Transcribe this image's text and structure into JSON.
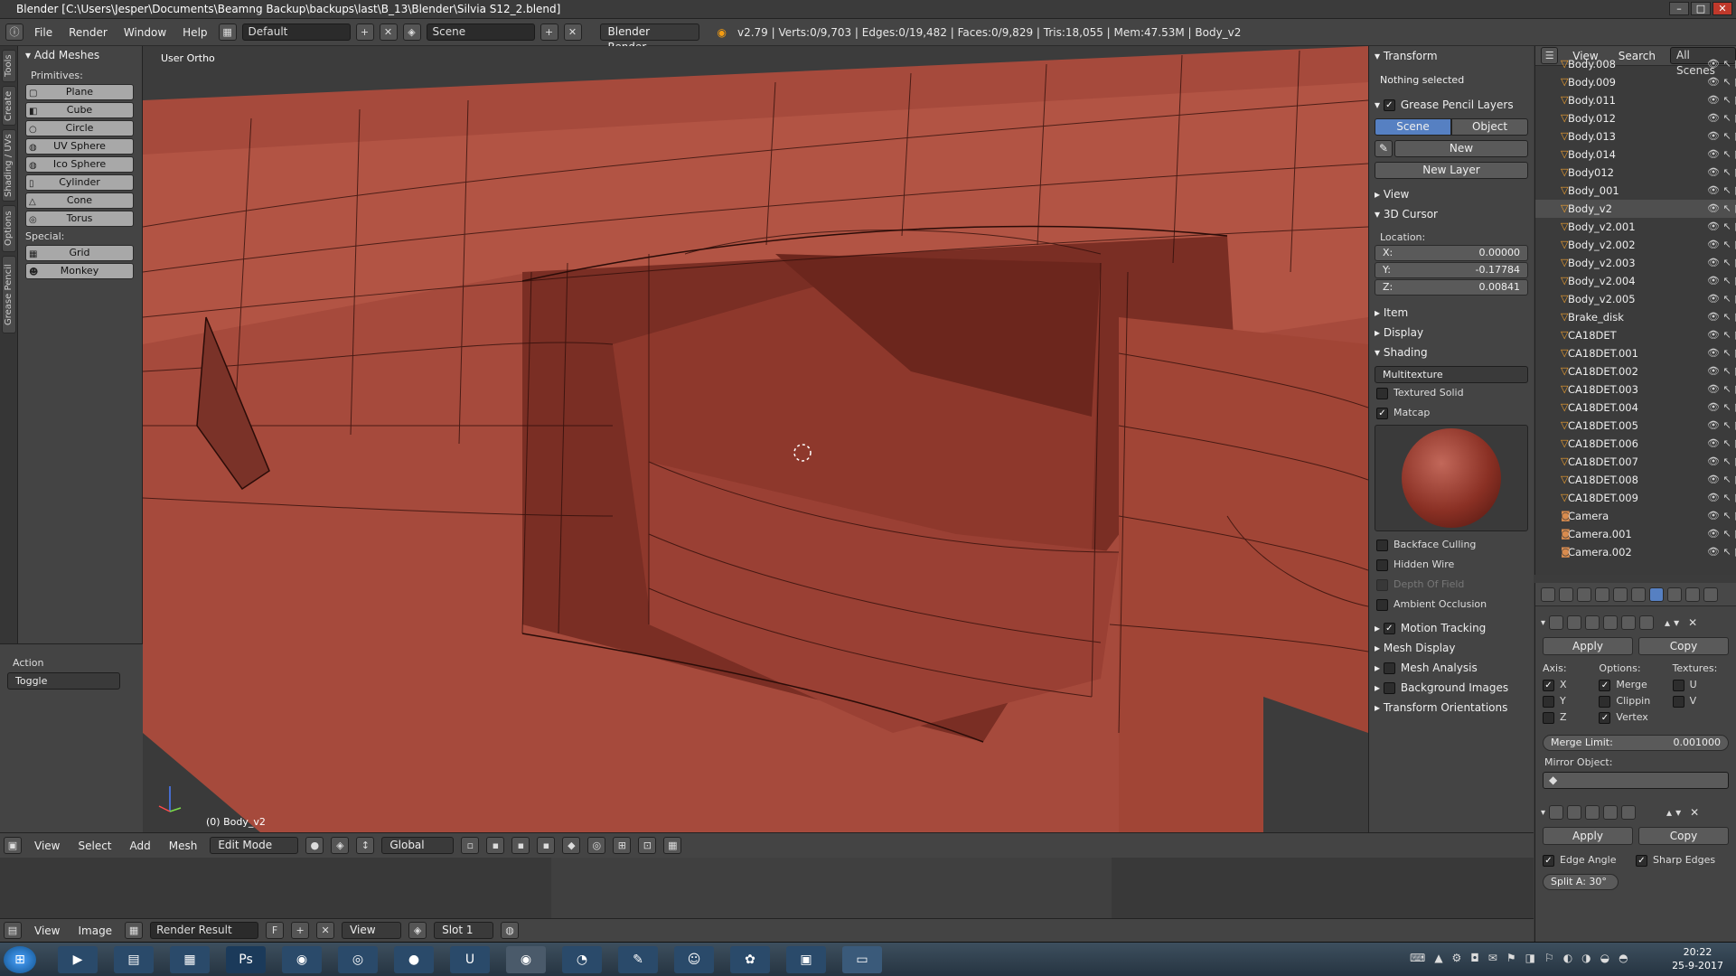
{
  "window": {
    "title": "Blender [C:\\Users\\Jesper\\Documents\\Beamng Backup\\backups\\last\\B_13\\Blender\\Silvia S12_2.blend]"
  },
  "topbar": {
    "menus": [
      "File",
      "Render",
      "Window",
      "Help"
    ],
    "layout": "Default",
    "scene": "Scene",
    "engine": "Blender Render",
    "stats": "v2.79 | Verts:0/9,703 | Edges:0/19,482 | Faces:0/9,829 | Tris:18,055 | Mem:47.53M | Body_v2"
  },
  "left_tabs": [
    "Tools",
    "Create",
    "Shading / UVs",
    "Options",
    "Grease Pencil"
  ],
  "toolshelf": {
    "header": "Add Meshes",
    "primitives_label": "Primitives:",
    "primitives": [
      "Plane",
      "Cube",
      "Circle",
      "UV Sphere",
      "Ico Sphere",
      "Cylinder",
      "Cone",
      "Torus"
    ],
    "special_label": "Special:",
    "special": [
      "Grid",
      "Monkey"
    ],
    "action_label": "Action",
    "action_value": "Toggle"
  },
  "viewport": {
    "view_label": "User Ortho",
    "object_label": "(0) Body_v2",
    "mesh_color": "#9e4236"
  },
  "npanel": {
    "transform": "Transform",
    "nothing_selected": "Nothing selected",
    "grease_pencil": "Grease Pencil Layers",
    "gp_scene": "Scene",
    "gp_object": "Object",
    "gp_new": "New",
    "gp_new_layer": "New Layer",
    "view": "View",
    "cursor": "3D Cursor",
    "location": "Location:",
    "x_label": "X:",
    "x_value": "0.00000",
    "y_label": "Y:",
    "y_value": "-0.17784",
    "z_label": "Z:",
    "z_value": "0.00841",
    "item": "Item",
    "display": "Display",
    "shading": "Shading",
    "shading_mode": "Multitexture",
    "textured_solid": "Textured Solid",
    "matcap": "Matcap",
    "backface": "Backface Culling",
    "hidden_wire": "Hidden Wire",
    "depth_of_field": "Depth Of Field",
    "ambient": "Ambient Occlusion",
    "motion_tracking": "Motion Tracking",
    "mesh_display": "Mesh Display",
    "mesh_analysis": "Mesh Analysis",
    "background_images": "Background Images",
    "transform_orientations": "Transform Orientations"
  },
  "outliner": {
    "menus": [
      "View",
      "Search"
    ],
    "filter": "All Scenes",
    "items": [
      "Body.008",
      "Body.009",
      "Body.011",
      "Body.012",
      "Body.013",
      "Body.014",
      "Body012",
      "Body_001",
      "Body_v2",
      "Body_v2.001",
      "Body_v2.002",
      "Body_v2.003",
      "Body_v2.004",
      "Body_v2.005",
      "Brake_disk",
      "CA18DET",
      "CA18DET.001",
      "CA18DET.002",
      "CA18DET.003",
      "CA18DET.004",
      "CA18DET.005",
      "CA18DET.006",
      "CA18DET.007",
      "CA18DET.008",
      "CA18DET.009",
      "Camera",
      "Camera.001",
      "Camera.002"
    ]
  },
  "properties": {
    "mirror": {
      "apply": "Apply",
      "copy": "Copy",
      "axis": "Axis:",
      "options": "Options:",
      "textures": "Textures:",
      "x": "X",
      "y": "Y",
      "z": "Z",
      "merge": "Merge",
      "clipping": "Clippin",
      "vertex": "Vertex",
      "u": "U",
      "v": "V",
      "merge_limit_label": "Merge Limit:",
      "merge_limit": "0.001000",
      "mirror_object": "Mirror Object:"
    },
    "edgesplit": {
      "apply": "Apply",
      "copy": "Copy",
      "edge_angle": "Edge Angle",
      "sharp_edges": "Sharp Edges",
      "split": "Split A: 30°"
    }
  },
  "viewport_header": {
    "menus": [
      "View",
      "Select",
      "Add",
      "Mesh"
    ],
    "mode": "Edit Mode",
    "orientation": "Global"
  },
  "image_header": {
    "menus": [
      "View",
      "Image"
    ],
    "image": "Render Result",
    "f": "F",
    "view": "View",
    "slot": "Slot 1"
  },
  "taskbar": {
    "time": "20:22",
    "date": "25-9-2017"
  }
}
